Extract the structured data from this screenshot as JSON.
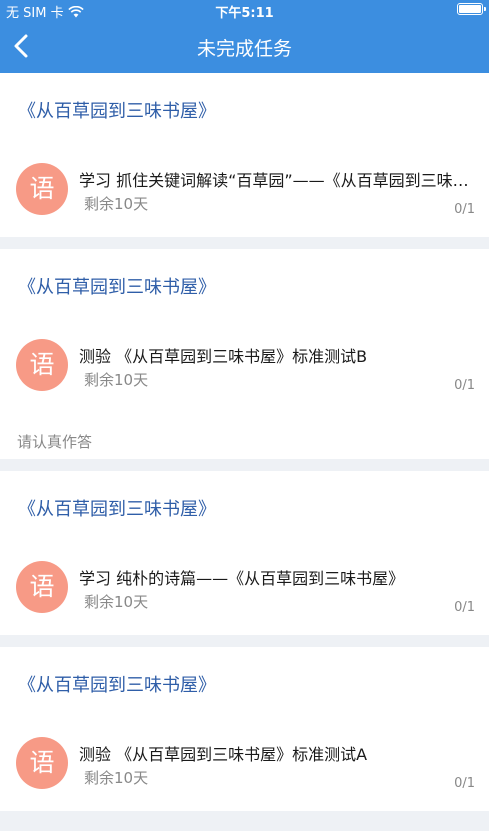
{
  "status_bar": {
    "carrier": "无 SIM 卡",
    "time": "下午5:11"
  },
  "nav": {
    "title": "未完成任务",
    "back_icon": "chevron-left-icon"
  },
  "colors": {
    "nav_background": "#3c8ee0",
    "title_text": "#2f5ea8",
    "avatar": "#f79a86"
  },
  "tasks": [
    {
      "title": "《从百草园到三味书屋》",
      "subject": "语",
      "name": "学习 抓住关键词解读“百草园”——《从百草园到三味书屋》",
      "remaining": "剩余10天",
      "progress": "0/1",
      "note": ""
    },
    {
      "title": "《从百草园到三味书屋》",
      "subject": "语",
      "name": "测验 《从百草园到三味书屋》标准测试B",
      "remaining": "剩余10天",
      "progress": "0/1",
      "note": "请认真作答"
    },
    {
      "title": "《从百草园到三味书屋》",
      "subject": "语",
      "name": "学习  纯朴的诗篇——《从百草园到三味书屋》",
      "remaining": "剩余10天",
      "progress": "0/1",
      "note": ""
    },
    {
      "title": "《从百草园到三味书屋》",
      "subject": "语",
      "name": "测验 《从百草园到三味书屋》标准测试A",
      "remaining": "剩余10天",
      "progress": "0/1",
      "note": ""
    }
  ]
}
